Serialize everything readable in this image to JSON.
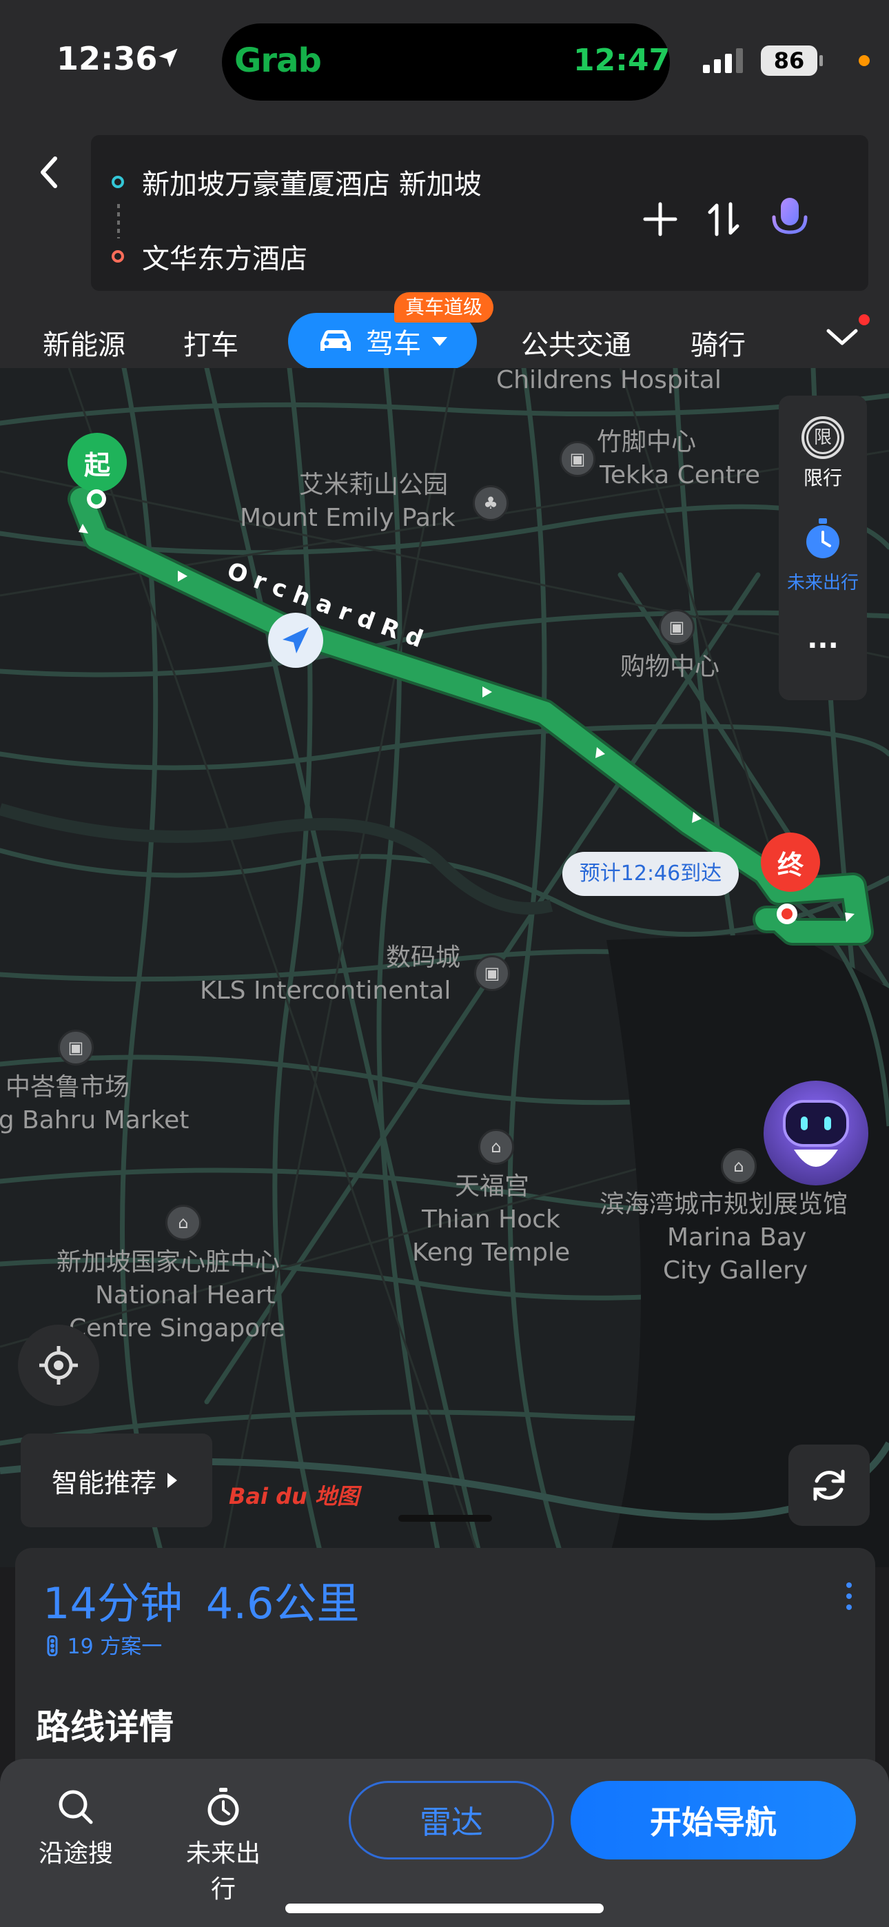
{
  "status_bar": {
    "time": "12:36",
    "app_pill_logo": "Grab",
    "app_pill_time": "12:47",
    "battery": "86"
  },
  "route": {
    "start": "新加坡万豪董厦酒店 新加坡",
    "end": "文华东方酒店"
  },
  "mode_tabs": {
    "new_energy": "新能源",
    "taxi": "打车",
    "drive": "驾车",
    "drive_badge": "真车道级",
    "transit": "公共交通",
    "bike": "骑行"
  },
  "map": {
    "labels": {
      "childrens_hospital": "Childrens Hospital",
      "tekka_cn": "竹脚中心",
      "tekka_en": "Tekka Centre",
      "emily_cn": "艾米莉山公园",
      "emily_en": "Mount Emily Park",
      "mall_cn": "购物中心",
      "orchard": "O r c h a r d  R d",
      "digital_cn": "数码城",
      "kls_en": "KLS Intercontinental",
      "tiong_cn": "中峇鲁市场",
      "tiong_en": "Tiong Bahru Market",
      "tianfu_cn": "天福宫",
      "tianfu_en1": "Thian Hock",
      "tianfu_en2": "Keng Temple",
      "marina_cn": "滨海湾城市规划展览馆",
      "marina_en1": "Marina Bay",
      "marina_en2": "City Gallery",
      "heart_cn": "新加坡国家心脏中心",
      "heart_en1": "National Heart",
      "heart_en2": "Centre Singapore"
    },
    "start_marker": "起",
    "end_marker": "终",
    "eta": "预计12:46到达",
    "side_panel": {
      "restrict_icon": "限",
      "restrict": "限行",
      "future_trip": "未来出行",
      "more": "···"
    },
    "smart_recommend": "智能推荐",
    "baidu_logo": "Bai du 地图"
  },
  "summary": {
    "duration": "14分钟",
    "distance": "4.6公里",
    "lights": "19",
    "plan": "方案一",
    "details_title": "路线详情"
  },
  "bottom_bar": {
    "search_along": "沿途搜",
    "future_trip": "未来出行",
    "radar": "雷达",
    "start_nav": "开始导航"
  },
  "colors": {
    "route_green": "#27a35a",
    "accent_blue": "#1a8cff",
    "badge_orange": "#ff6a1a",
    "start_green": "#1fb35a",
    "end_red": "#f23a2e"
  }
}
